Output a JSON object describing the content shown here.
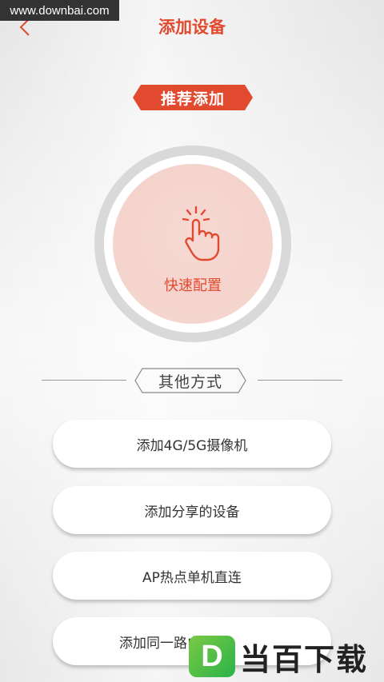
{
  "watermark": {
    "text": "www.downbai.com"
  },
  "header": {
    "title": "添加设备"
  },
  "recommend": {
    "label": "推荐添加",
    "quick_config_label": "快速配置"
  },
  "other": {
    "label": "其他方式"
  },
  "options": [
    {
      "label": "添加4G/5G摄像机"
    },
    {
      "label": "添加分享的设备"
    },
    {
      "label": "AP热点单机直连"
    },
    {
      "label": "添加同一路由"
    }
  ],
  "brand": {
    "logo_letter": "D",
    "text": "当百下载"
  },
  "colors": {
    "accent": "#e24a30",
    "ring": "#d9d9d9",
    "quick_bg": "#f4d3cc"
  }
}
